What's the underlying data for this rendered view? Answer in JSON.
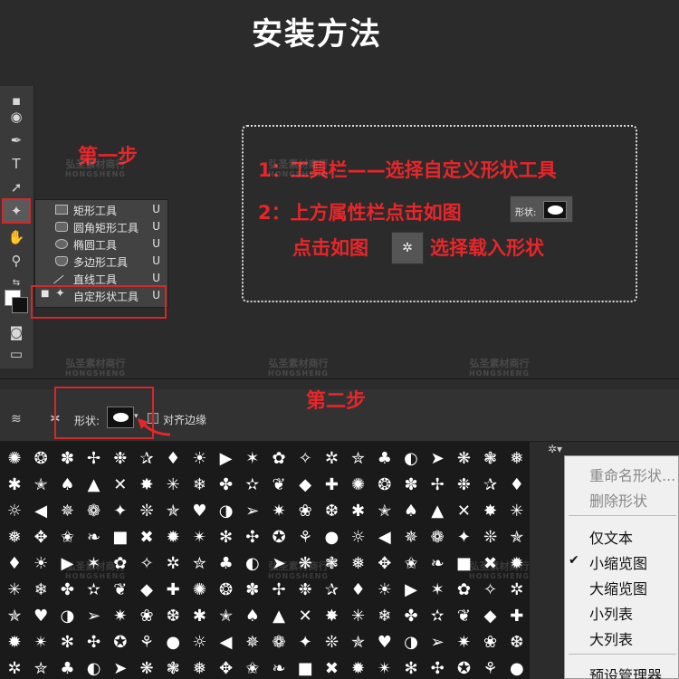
{
  "title": "安装方法",
  "step1_label": "第一步",
  "step2_label": "第二步",
  "instructions": {
    "line1": "1：工具栏——选择自定义形状工具",
    "line2": "2：上方属性栏点击如图",
    "line3a": "点击如图",
    "line3b": "选择载入形状",
    "chip_shape_label": "形状:",
    "gear_glyph": "✲"
  },
  "flyout": {
    "items": [
      {
        "label": "矩形工具",
        "key": "U"
      },
      {
        "label": "圆角矩形工具",
        "key": "U"
      },
      {
        "label": "椭圆工具",
        "key": "U"
      },
      {
        "label": "多边形工具",
        "key": "U"
      },
      {
        "label": "直线工具",
        "key": "U"
      },
      {
        "label": "自定形状工具",
        "key": "U"
      }
    ],
    "selected_marker": "■"
  },
  "options_bar": {
    "shape_label": "形状:",
    "align_edges": "对齐边缘"
  },
  "context_menu": {
    "items": [
      {
        "label": "重命名形状...",
        "disabled": true
      },
      {
        "label": "删除形状",
        "disabled": true
      },
      {
        "label": "仅文本",
        "disabled": false
      },
      {
        "label": "小缩览图",
        "disabled": false,
        "checked": true
      },
      {
        "label": "大缩览图",
        "disabled": false
      },
      {
        "label": "小列表",
        "disabled": false
      },
      {
        "label": "大列表",
        "disabled": false
      },
      {
        "label": "预设管理器...",
        "disabled": false
      }
    ],
    "check_glyph": "✔"
  },
  "watermark": {
    "cn": "弘圣素材商行",
    "en": "HONGSHENG"
  },
  "shape_glyphs": [
    "✺",
    "✹",
    "✸",
    "❋",
    "✷",
    "✶",
    "✵",
    "❂",
    "✴",
    "✳",
    "❃",
    "❀",
    "✿",
    "❁",
    "✽",
    "✻",
    "❄",
    "❅",
    "❆",
    "✧",
    "✦",
    "✢",
    "✣",
    "✤",
    "✥",
    "✱",
    "✲",
    "❊",
    "❉",
    "✪",
    "✫",
    "✬",
    "✭",
    "✮",
    "✯",
    "✰",
    "⚘",
    "❦",
    "❧",
    "♠",
    "♣",
    "♥",
    "♦",
    "●",
    "◆",
    "■",
    "▲",
    "◐",
    "◑",
    "☀",
    "☼",
    "✚",
    "✖",
    "✕",
    "➤",
    "➢",
    "▶",
    "◀"
  ]
}
